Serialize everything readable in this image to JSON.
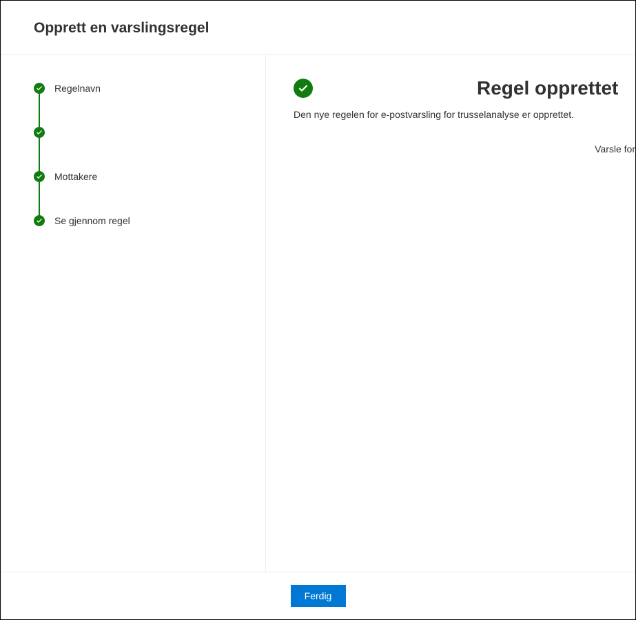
{
  "dialog": {
    "title": "Opprett en varslingsregel"
  },
  "steps": [
    {
      "label": "Regelnavn"
    },
    {
      "label": ""
    },
    {
      "label": "Mottakere"
    },
    {
      "label": "Se gjennom regel"
    }
  ],
  "success": {
    "title": "Regel opprettet",
    "description": "Den nye regelen for e-postvarsling for trusselanalyse er opprettet.",
    "detail_label": "Varsle for"
  },
  "footer": {
    "done_label": "Ferdig"
  }
}
